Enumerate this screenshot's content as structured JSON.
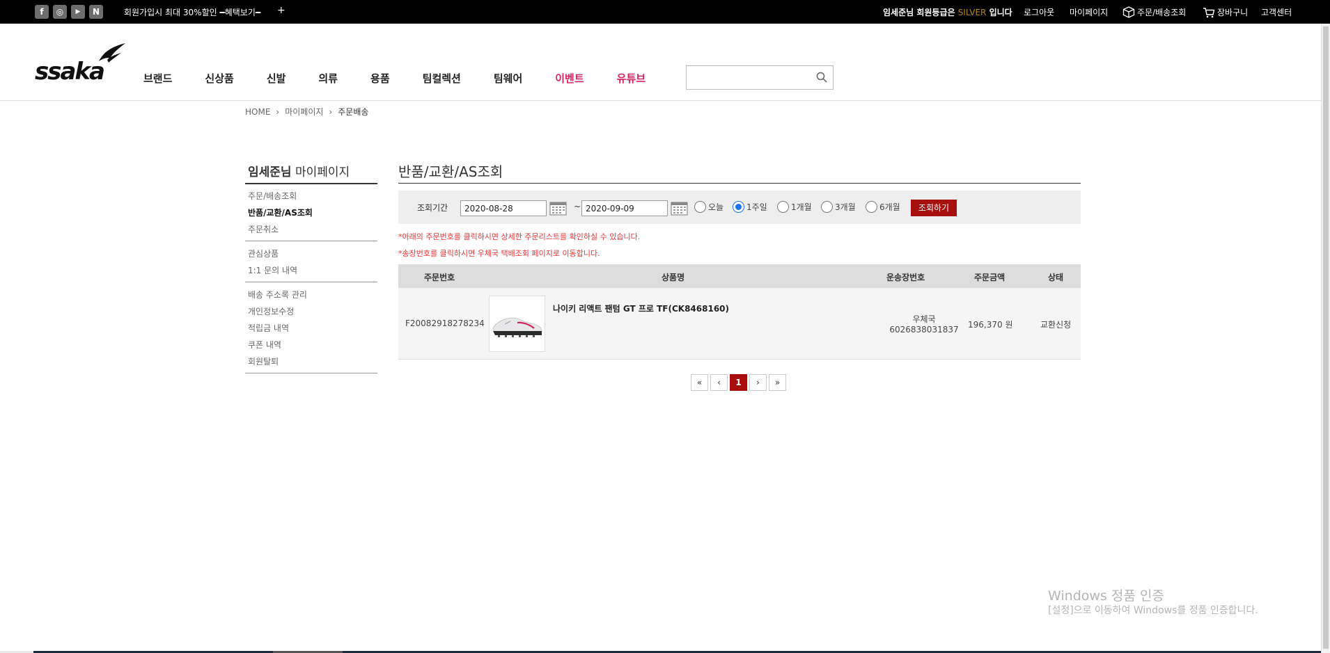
{
  "topbar": {
    "social": [
      {
        "icon": "facebook-icon",
        "glyph": "f"
      },
      {
        "icon": "instagram-icon",
        "glyph": "◎"
      },
      {
        "icon": "youtube-icon",
        "glyph": "▶"
      },
      {
        "icon": "naver-blog-icon",
        "glyph": "N"
      }
    ],
    "promo": "회원가입시 최대 30%할인 ━혜택보기━",
    "promo_plus": "+",
    "member_text": "임세준님 회원등급은",
    "member_grade": "SILVER",
    "member_suffix": "입니다",
    "links": {
      "logout": "로그아웃",
      "mypage": "마이페이지",
      "order_delivery": "주문/배송조회",
      "cart": "장바구니",
      "customer_center": "고객센터"
    }
  },
  "header": {
    "logo": "ssaka",
    "nav": [
      {
        "label": "브랜드",
        "color": "#222222"
      },
      {
        "label": "신상품",
        "color": "#222222"
      },
      {
        "label": "신발",
        "color": "#222222"
      },
      {
        "label": "의류",
        "color": "#222222"
      },
      {
        "label": "용품",
        "color": "#222222"
      },
      {
        "label": "팀컬렉션",
        "color": "#222222"
      },
      {
        "label": "팀웨어",
        "color": "#222222"
      },
      {
        "label": "이벤트",
        "color": "#d6245f"
      },
      {
        "label": "유튜브",
        "color": "#d6245f"
      }
    ],
    "search_value": ""
  },
  "breadcrumb": {
    "home": "HOME",
    "mypage": "마이페이지",
    "current": "주문배송"
  },
  "sidebar": {
    "user_name": "임세준님",
    "title_suffix": "마이페이지",
    "groups": [
      [
        "주문/배송조회",
        "반품/교환/AS조회",
        "주문취소"
      ],
      [
        "관심상품",
        "1:1 문의 내역"
      ],
      [
        "배송 주소록 관리",
        "개인정보수정",
        "적립금 내역",
        "쿠폰 내역",
        "회원탈퇴"
      ]
    ],
    "active": "반품/교환/AS조회"
  },
  "main": {
    "title": "반품/교환/AS조회",
    "filter": {
      "label": "조회기간",
      "start_date": "2020-08-28",
      "end_date": "2020-09-09",
      "tilde": "~",
      "periods": [
        "오늘",
        "1주일",
        "1개월",
        "3개월",
        "6개월"
      ],
      "selected_period": "1주일",
      "search_button": "조회하기"
    },
    "notices": [
      "*아래의 주문번호를 클릭하시면 상세한 주문리스트를 확인하실 수 있습니다.",
      "*송장번호를 클릭하시면 우체국 택배조회 페이지로 이동합니다."
    ],
    "table": {
      "headers": [
        "주문번호",
        "상품명",
        "운송장번호",
        "주문금액",
        "상태"
      ],
      "rows": [
        {
          "order_no": "F20082918278234",
          "product": "나이키 리액트 팬텀 GT 프로 TF(CK8468160)",
          "carrier": "우체국",
          "tracking_no": "6026838031837",
          "amount": "196,370 원",
          "status": "교환신청"
        }
      ]
    },
    "pagination": {
      "first": "«",
      "prev": "‹",
      "current": "1",
      "next": "›",
      "last": "»"
    }
  },
  "watermark": {
    "line1": "Windows 정품 인증",
    "line2": "[설정]으로 이동하여 Windows를 정품 인증합니다."
  },
  "colors": {
    "accent": "#a70e0e",
    "notice": "#e53535",
    "nav_highlight": "#d6245f",
    "grade": "#b8860b"
  }
}
